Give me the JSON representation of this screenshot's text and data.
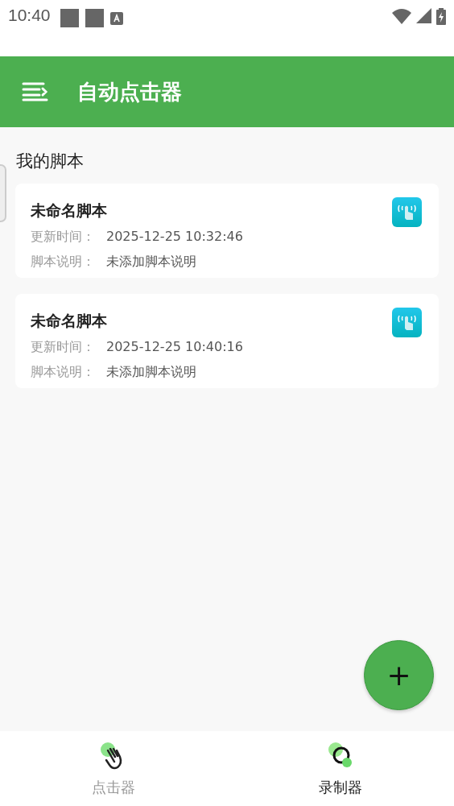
{
  "status_bar": {
    "time": "10:40"
  },
  "app_bar": {
    "title": "自动点击器"
  },
  "section_title": "我的脚本",
  "scripts": [
    {
      "name": "未命名脚本",
      "time_label": "更新时间：",
      "time": "2025-12-25 10:32:46",
      "desc_label": "脚本说明：",
      "desc": "未添加脚本说明"
    },
    {
      "name": "未命名脚本",
      "time_label": "更新时间：",
      "time": "2025-12-25 10:40:16",
      "desc_label": "脚本说明：",
      "desc": "未添加脚本说明"
    }
  ],
  "fab": {
    "label": "+"
  },
  "bottom_nav": [
    {
      "label": "点击器",
      "kind": "clicker",
      "selected": false
    },
    {
      "label": "录制器",
      "kind": "recorder",
      "selected": true
    }
  ]
}
